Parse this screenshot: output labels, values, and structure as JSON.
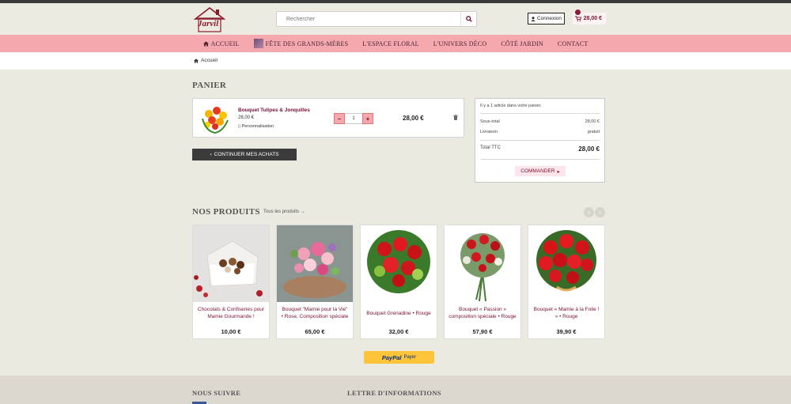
{
  "header": {
    "logo_text": "Jarvil",
    "search_placeholder": "Rechercher",
    "login_label": "Connexion",
    "cart_total": "28,00 €"
  },
  "nav": [
    {
      "label": "ACCUEIL",
      "icon": "home-icon"
    },
    {
      "label": "FÊTE DES GRANDS-MÈRES",
      "icon": "thumbnail"
    },
    {
      "label": "L'ESPACE FLORAL"
    },
    {
      "label": "L'UNIVERS DÉCO"
    },
    {
      "label": "CÔTÉ JARDIN"
    },
    {
      "label": "CONTACT"
    }
  ],
  "breadcrumb": {
    "home_label": "Accueil"
  },
  "cart": {
    "title": "PANIER",
    "item": {
      "name": "Bouquet Tulipes & Jonquilles",
      "price": "28,00 €",
      "customization": "Personnalisation",
      "quantity": "1",
      "line_total": "28,00 €"
    },
    "continue_label": "CONTINUER MES ACHATS"
  },
  "summary": {
    "count_text": "Il y a 1 article dans votre panier.",
    "subtotal_label": "Sous-total",
    "subtotal_value": "28,00 €",
    "shipping_label": "Livraison",
    "shipping_value": "gratuit",
    "total_label": "Total TTC",
    "total_value": "28,00 €",
    "order_label": "COMMANDER"
  },
  "products": {
    "title": "NOS PRODUITS",
    "all_link": "Tous les produits →",
    "items": [
      {
        "name": "Chocolats & Confiseries pour Mamie Gourmande !",
        "price": "10,00 €"
      },
      {
        "name": "Bouquet \"Mamie pour la Vie\" • Rose, Composition spéciale",
        "price": "65,00 €"
      },
      {
        "name": "Bouquet Grenadine • Rouge",
        "price": "32,00 €"
      },
      {
        "name": "Bouquet « Passion » composition spéciale • Rouge",
        "price": "57,90 €"
      },
      {
        "name": "Bouquet « Mamie à la Folie ! » • Rouge",
        "price": "39,90 €"
      }
    ]
  },
  "paypal": {
    "brand": "PayPal",
    "label": "Payer"
  },
  "footer": {
    "follow_title": "NOUS SUIVRE",
    "newsletter_title": "LETTRE D'INFORMATIONS"
  },
  "colors": {
    "accent": "#7a1030",
    "nav_bg": "#f5a9ae",
    "page_bg": "#ebeae0"
  }
}
